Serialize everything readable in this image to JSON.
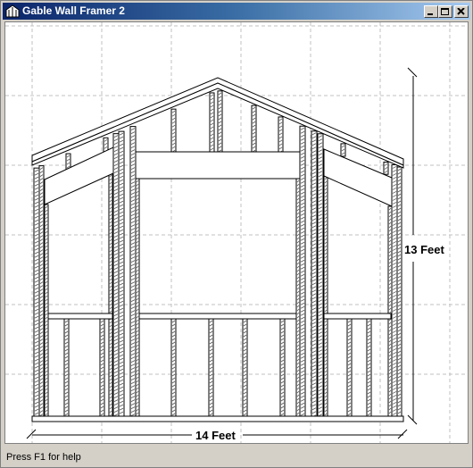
{
  "window": {
    "title": "Gable Wall Framer 2"
  },
  "drawing": {
    "height_label": "13 Feet",
    "width_label": "14 Feet"
  },
  "status": {
    "text": "Press F1 for help"
  }
}
